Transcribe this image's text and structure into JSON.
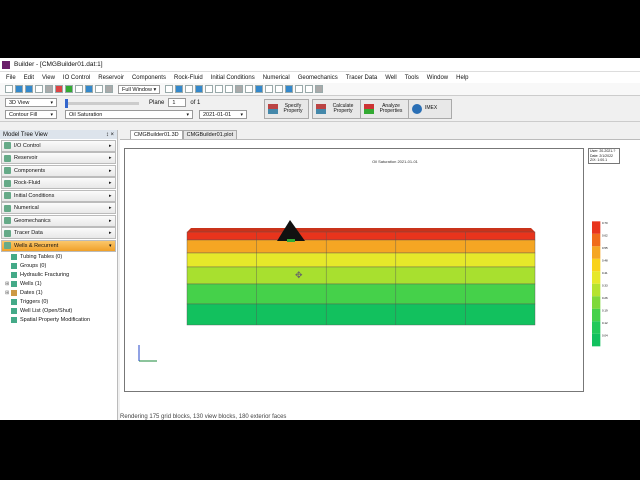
{
  "window": {
    "title": "Builder - [CMGBuilder01.dat:1]"
  },
  "menu": [
    "File",
    "Edit",
    "View",
    "IO Control",
    "Reservoir",
    "Components",
    "Rock-Fluid",
    "Initial Conditions",
    "Numerical",
    "Geomechanics",
    "Tracer Data",
    "Well",
    "Tools",
    "Window",
    "Help"
  ],
  "toolbar": {
    "view_mode": "Full Window"
  },
  "options": {
    "view_type": "3D View",
    "display_type": "Contour Fill",
    "property": "Oil Saturation",
    "plane_label": "Plane",
    "plane_value": "1",
    "plane_of": "of 1",
    "date": "2021-01-01"
  },
  "buttons": {
    "specify_property": "Specify Property",
    "calculate_property": "Calculate Property",
    "analyze_properties": "Analyze Properties",
    "imex": "IMEX"
  },
  "tree_panel": {
    "title": "Model Tree View",
    "pin_symbols": "↕ ×",
    "nav_items": [
      "I/O Control",
      "Reservoir",
      "Components",
      "Rock-Fluid",
      "Initial Conditions",
      "Numerical",
      "Geomechanics",
      "Tracer Data",
      "Wells & Recurrent"
    ],
    "tree_items": [
      "Tubing Tables (0)",
      "Groups (0)",
      "Hydraulic Fracturing",
      "Wells (1)",
      "Dates (1)",
      "Triggers (0)",
      "Well List (Open/Shut)",
      "Spatial Property Modification"
    ]
  },
  "tabs": [
    "CMGBuilder01.3D",
    "CMGBuilder01.plot"
  ],
  "plot": {
    "header": "Oil Saturation 2021-01-01",
    "info_lines": [
      "User: 20-2021-?",
      "Date: 2/1/2022",
      "Z/X: 1:00.1"
    ],
    "legend_values": [
      "0.70",
      "0.62",
      "0.55",
      "0.48",
      "0.41",
      "0.33",
      "0.26",
      "0.19",
      "0.12",
      "0.04"
    ],
    "legend_colors": [
      "#e8341c",
      "#f06b1a",
      "#f5a623",
      "#f9d21a",
      "#e6e82a",
      "#b5e32f",
      "#7ed93a",
      "#45d14a",
      "#22c95a",
      "#12c15e"
    ],
    "layer_colors": [
      "#e8341c",
      "#f5a623",
      "#e6e82a",
      "#a8e02f",
      "#45d14a",
      "#12c15e"
    ]
  },
  "status": {
    "text": "Rendering 175 grid blocks, 130 view blocks, 180 exterior faces"
  }
}
